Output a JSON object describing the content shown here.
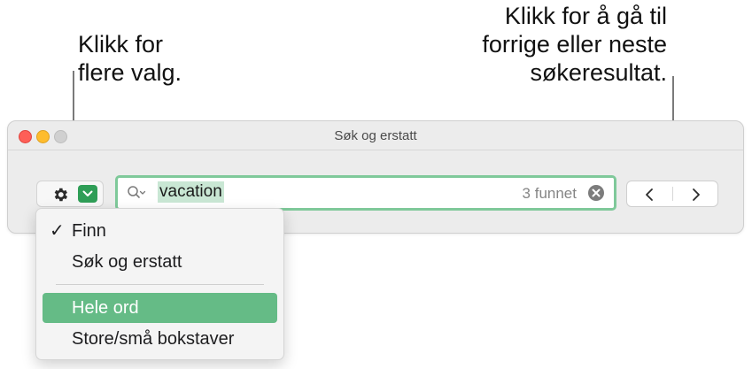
{
  "callouts": {
    "more_options": [
      "Klikk for",
      "flere valg."
    ],
    "navigate_results": [
      "Klikk for å gå til",
      "forrige eller neste",
      "søkeresultat."
    ]
  },
  "window": {
    "title": "Søk og erstatt"
  },
  "search": {
    "value": "vacation",
    "match_count": "3 funnet"
  },
  "menu": {
    "items": [
      {
        "label": "Finn",
        "checked": true
      },
      {
        "label": "Søk og erstatt",
        "checked": false
      },
      {
        "label": "Hele ord",
        "checked": false,
        "highlighted": true
      },
      {
        "label": "Store/små bokstaver",
        "checked": false
      }
    ],
    "check_mark": "✓"
  },
  "icons": {
    "options": "gear-icon",
    "dropdown": "chevron-down-icon",
    "search": "magnifier-icon",
    "clear": "clear-icon",
    "previous": "chevron-left-icon",
    "next": "chevron-right-icon"
  },
  "colors": {
    "accent": "#2f9e57",
    "field_focus_ring": "#7fc99a",
    "menu_highlight": "#65bb86",
    "selection": "#c9e7d4"
  }
}
